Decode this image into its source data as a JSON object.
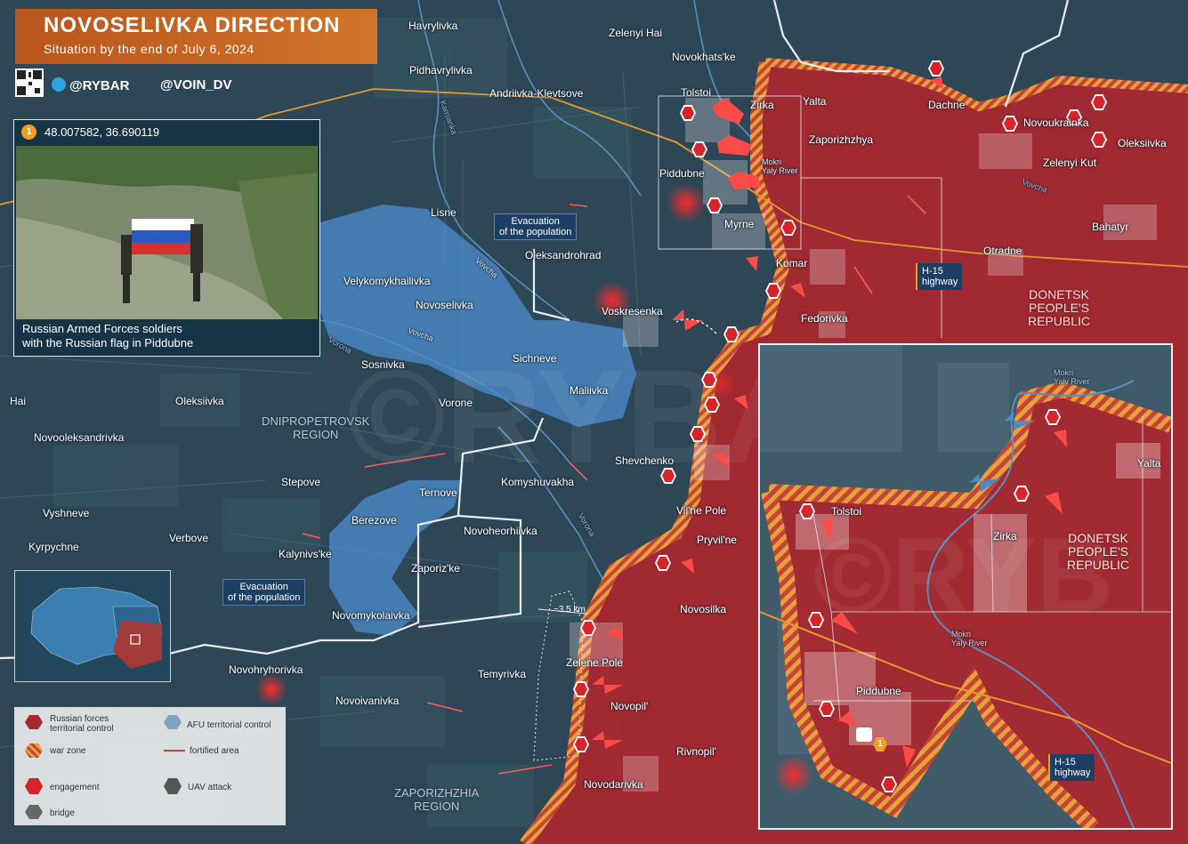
{
  "header": {
    "title": "NOVOSELIVKA DIRECTION",
    "subtitle": "Situation by the end of July 6, 2024",
    "telegram": "@RYBAR",
    "channel": "@VOIN_DV"
  },
  "photo_card": {
    "marker_number": "1",
    "coordinates": "48.007582, 36.690119",
    "caption_line1": "Russian Armed Forces soldiers",
    "caption_line2": "with the Russian flag in Piddubne"
  },
  "callouts": {
    "evacuation_north": [
      "Evacuation",
      "of the population"
    ],
    "evacuation_south": [
      "Evacuation",
      "of the population"
    ],
    "highway_main": [
      "H-15",
      "highway"
    ],
    "highway_inset": [
      "H-15",
      "highway"
    ],
    "distance": "~3.5 km"
  },
  "regions": {
    "dnipropetrovsk": [
      "DNIPROPETROVSK",
      "REGION"
    ],
    "zaporizhzhia": [
      "ZAPORIZHZHIA",
      "REGION"
    ],
    "donetsk": [
      "DONETSK",
      "PEOPLE'S",
      "REPUBLIC"
    ],
    "donetsk_inset": [
      "DONETSK",
      "PEOPLE'S",
      "REPUBLIC"
    ]
  },
  "rivers": {
    "vovcha_1": "Vovcha",
    "vovcha_2": "Vovcha",
    "vovcha_3": "Vovcha",
    "vorona_1": "Vorona",
    "vorona_2": "Vorona",
    "kamianka": "Kamianka",
    "mokri_yaly_1": "Mokri\nYaly River",
    "mokri_yaly_inset_1": "Mokri\nYaly River",
    "mokri_yaly_inset_2": "Mokri\nYaly River"
  },
  "settlements": {
    "havrylivka": "Havrylivka",
    "pidhavrylivka": "Pidhavrylivka",
    "andriivka_klevtsove": "Andriivka-Klevtsove",
    "zelenyi_hai": "Zelenyi Hai",
    "novokhatske": "Novokhats'ke",
    "tolstoi": "Tolstoi",
    "zirka": "Zirka",
    "yalta": "Yalta",
    "dachne": "Dachne",
    "novoukrainka": "Novoukrainka",
    "oleksiivka_east": "Oleksiivka",
    "zaporizhzhya": "Zaporizhzhya",
    "zelenyi_kut": "Zelenyi Kut",
    "piddubne": "Piddubne",
    "myrne": "Myrne",
    "bahatyr": "Bahatyr",
    "komar": "Komar",
    "otradne": "Otradne",
    "lisne": "Lisne",
    "oleksandrohrad": "Oleksandrohrad",
    "velykomykhailivka": "Velykomykhailivka",
    "novoselivka": "Novoselivka",
    "voskresenka": "Voskresenka",
    "fedorivka": "Fedorivka",
    "sichneve": "Sichneve",
    "sosnivka": "Sosnivka",
    "maliivka": "Maliivka",
    "vorone": "Vorone",
    "hai": "Hai",
    "oleksiivka_west": "Oleksiivka",
    "novooleksandrivka": "Novooleksandrivka",
    "shevchenko": "Shevchenko",
    "komyshuvakha": "Komyshuvakha",
    "stepove": "Stepove",
    "ternove": "Ternove",
    "vilne_pole": "Vil'ne Pole",
    "vyshneve": "Vyshneve",
    "verbove": "Verbove",
    "berezove": "Berezove",
    "novoheorhiivka": "Novoheorhiivka",
    "pryvilne": "Pryvil'ne",
    "kyrpychne": "Kyrpychne",
    "kalynivske": "Kalynivs'ke",
    "zaporizke": "Zaporiz'ke",
    "novomykolaivka": "Novomykolaivka",
    "novosilka": "Novosilka",
    "zelene_pole": "Zelene Pole",
    "temyrivka": "Temyrivka",
    "novohryhorivka": "Novohryhorivka",
    "novopil": "Novopil'",
    "novoivanivka": "Novoivanivka",
    "rivnopil": "Rivnopil'",
    "novodarivka": "Novodarivka"
  },
  "inset": {
    "tolstoi": "Tolstoi",
    "zirka": "Zirka",
    "yalta": "Yalta",
    "piddubne": "Piddubne",
    "marker_number": "1"
  },
  "legend": {
    "russian_control": [
      "Russian forces",
      "territorial control"
    ],
    "afu_control": "AFU territorial control",
    "war_zone": "war zone",
    "fortified_area": "fortified area",
    "engagement": "engagement",
    "uav_attack": "UAV attack",
    "bridge": "bridge"
  },
  "colors": {
    "russian_control": "#b3262f",
    "afu_control": "#3f7fc1",
    "war_zone": "#e7a13a",
    "engagement": "#d8232a",
    "title_bar": "#c9651a",
    "background": "#2f4a5a"
  },
  "icons": {
    "engagement": "lightning-hexagon-icon",
    "uav": "drone-icon",
    "bridge": "bridge-icon",
    "settlement": "map-pin-icon",
    "telegram": "telegram-icon",
    "qr": "qr-code-icon"
  }
}
